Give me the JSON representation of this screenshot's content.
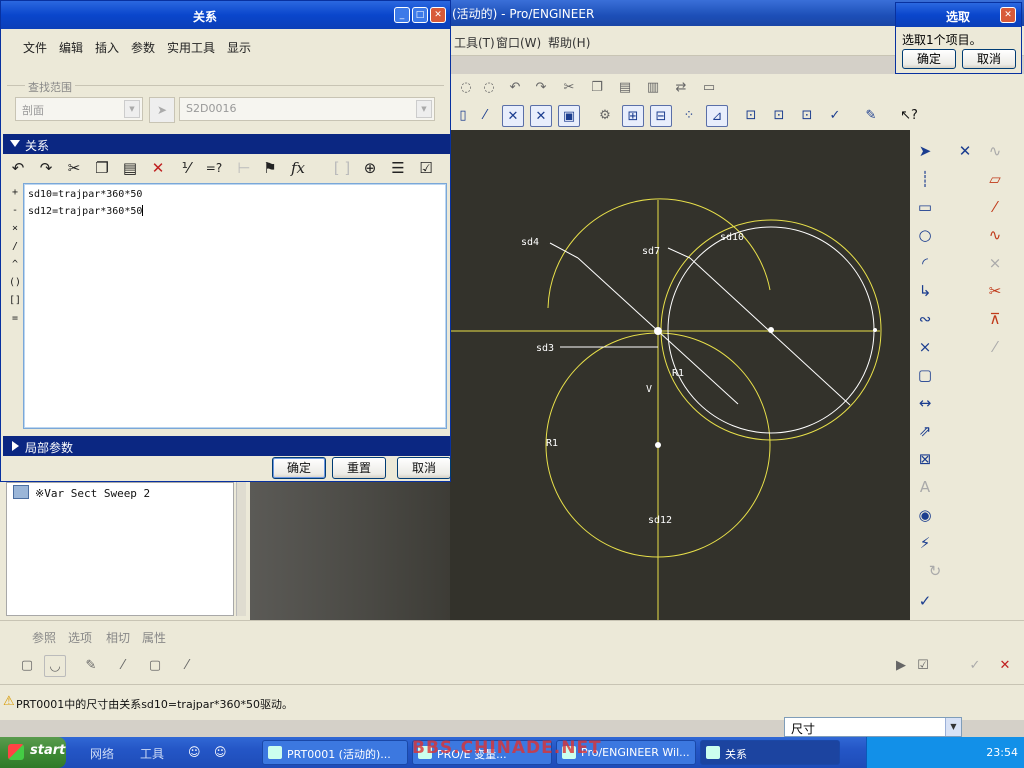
{
  "main_window": {
    "title": "(活动的) - Pro/ENGINEER"
  },
  "main_menu": {
    "tools": "工具(T)",
    "window": "窗口(W)",
    "help": "帮助(H)"
  },
  "relations_dialog": {
    "title": "关系",
    "menu": [
      "文件",
      "编辑",
      "插入",
      "参数",
      "实用工具",
      "显示"
    ],
    "lookup_group_label": "查找范围",
    "lookup_type": "剖面",
    "lookup_value": "S2D0016",
    "section_relations": "关系",
    "section_local_params": "局部参数",
    "operators": [
      "+",
      "-",
      "×",
      "/",
      "^",
      "()",
      "[]",
      "="
    ],
    "relations": [
      "sd10=trajpar*360*50",
      "sd12=trajpar*360*50"
    ],
    "buttons": {
      "ok": "确定",
      "reset": "重置",
      "cancel": "取消"
    },
    "toolbar_icons": [
      "undo-icon",
      "redo-icon",
      "cut-icon",
      "copy-icon",
      "paste-icon",
      "delete-icon",
      "dimension-icon",
      "evaluate-icon",
      "ruler-icon",
      "param-icon",
      "function-icon",
      "bracket-icon",
      "sort-icon",
      "list-icon",
      "verify-icon"
    ]
  },
  "select_dialog": {
    "title": "选取",
    "prompt": "选取1个项目。",
    "ok": "确定",
    "cancel": "取消"
  },
  "model_tree": {
    "item": "Var Sect Sweep 2"
  },
  "sketch": {
    "labels": {
      "sd4": "sd4",
      "sd7": "sd7",
      "sd10": "sd10",
      "sd3": "sd3",
      "sd12": "sd12",
      "r1a": "R1",
      "r1b": "R1",
      "v": "V"
    },
    "colors": {
      "line": "#e8e04a",
      "white": "#ffffff",
      "bg": "#33322b"
    }
  },
  "dashboard": {
    "tabs": [
      "参照",
      "选项",
      "相切",
      "属性"
    ]
  },
  "status": {
    "message": "PRT0001中的尺寸由关系sd10=trajpar*360*50驱动。",
    "filter": "尺寸"
  },
  "taskbar": {
    "start": "start",
    "quicklinks": [
      "网络",
      "工具"
    ],
    "tasks": [
      "PRT0001 (活动的)...",
      "PRO/E 变量...",
      "Pro/ENGINEER Wil...",
      "关系"
    ],
    "clock": "23:54",
    "watermark": "BBS.CHINADE.NET"
  }
}
